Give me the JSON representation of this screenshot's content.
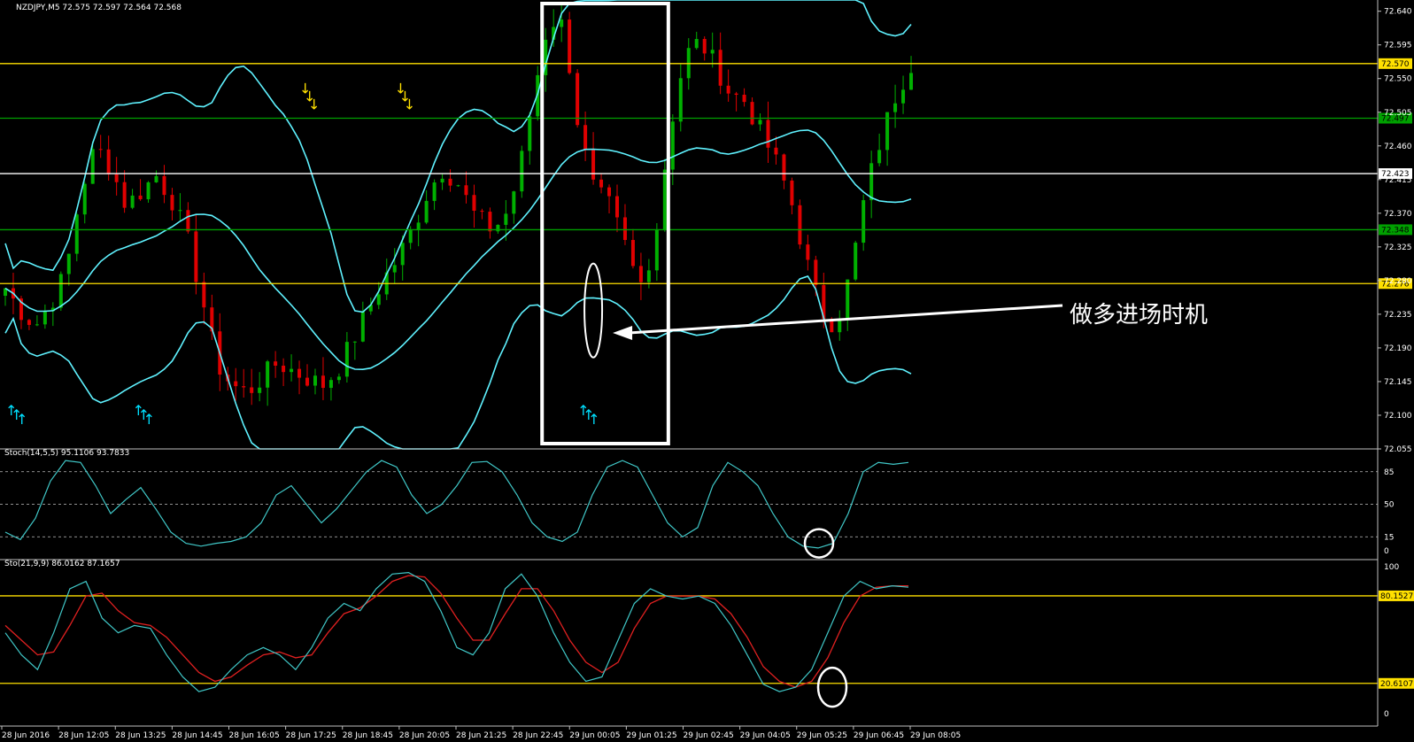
{
  "window": {
    "symbol_info": "NZDJPY,M5  72.575 72.597 72.564 72.568"
  },
  "annotation": {
    "text": "做多进场时机"
  },
  "colors": {
    "background": "#000000",
    "bull": "#00b000",
    "bear": "#e00000",
    "bands": "#5ff2ff",
    "hline_yellow": "#ffe000",
    "hline_green": "#00a000",
    "hline_white": "#ffffff",
    "stoch_main": "#40c8c8",
    "stoch_signal": "#e02020",
    "up_arrow": "#00e0ff",
    "down_arrow": "#ffe000",
    "highlight": "#ffffff"
  },
  "chart_data": [
    {
      "type": "candlestick",
      "title": "NZDJPY,M5",
      "ohlc_readout": [
        72.575,
        72.597,
        72.564,
        72.568
      ],
      "x_labels": [
        "28 Jun 2016",
        "28 Jun 12:05",
        "28 Jun 13:25",
        "28 Jun 14:45",
        "28 Jun 16:05",
        "28 Jun 17:25",
        "28 Jun 18:45",
        "28 Jun 20:05",
        "28 Jun 21:25",
        "28 Jun 22:45",
        "29 Jun 00:05",
        "29 Jun 01:25",
        "29 Jun 02:45",
        "29 Jun 04:05",
        "29 Jun 05:25",
        "29 Jun 06:45",
        "29 Jun 08:05"
      ],
      "y_ticks": [
        72.64,
        72.595,
        72.55,
        72.505,
        72.46,
        72.415,
        72.37,
        72.325,
        72.28,
        72.235,
        72.19,
        72.145,
        72.1,
        72.055
      ],
      "ylim": [
        72.055,
        72.655
      ],
      "close_path": [
        72.27,
        72.24,
        72.22,
        72.25,
        72.29,
        72.4,
        72.46,
        72.43,
        72.38,
        72.4,
        72.42,
        72.39,
        72.34,
        72.26,
        72.17,
        72.14,
        72.13,
        72.15,
        72.17,
        72.16,
        72.15,
        72.14,
        72.16,
        72.2,
        72.24,
        72.28,
        72.31,
        72.35,
        72.4,
        72.43,
        72.41,
        72.37,
        72.35,
        72.36,
        72.42,
        72.53,
        72.63,
        72.62,
        72.48,
        72.4,
        72.38,
        72.33,
        72.27,
        72.33,
        72.48,
        72.58,
        72.6,
        72.57,
        72.53,
        72.52,
        72.48,
        72.44,
        72.39,
        72.31,
        72.24,
        72.22,
        72.29,
        72.4,
        72.47,
        72.53,
        72.57
      ],
      "levels": [
        {
          "value": 72.57,
          "label": "72.570",
          "color": "#ffe000"
        },
        {
          "value": 72.497,
          "label": "72.497",
          "color": "#00a000"
        },
        {
          "value": 72.423,
          "label": "72.423",
          "color": "#ffffff"
        },
        {
          "value": 72.348,
          "label": "72.348",
          "color": "#00a000"
        },
        {
          "value": 72.276,
          "label": "72.276",
          "color": "#ffe000"
        }
      ],
      "up_arrow_clusters": [
        0,
        16,
        72
      ],
      "down_arrow_clusters": [
        37,
        49
      ],
      "highlight_box_bars": [
        68,
        83
      ]
    },
    {
      "type": "line",
      "title": "Stoch(14,5,5) 95.1106 93.7833",
      "ylim": [
        0,
        100
      ],
      "y_ticks": [
        85,
        50,
        15,
        0
      ],
      "levels": [
        85,
        50,
        15
      ],
      "main": [
        20,
        12,
        35,
        75,
        97,
        95,
        70,
        40,
        55,
        68,
        45,
        20,
        8,
        5,
        8,
        10,
        15,
        30,
        60,
        70,
        50,
        30,
        45,
        65,
        85,
        97,
        90,
        60,
        40,
        50,
        70,
        95,
        96,
        85,
        60,
        30,
        15,
        10,
        20,
        60,
        90,
        97,
        90,
        60,
        30,
        15,
        25,
        70,
        95,
        85,
        70,
        40,
        15,
        5,
        3,
        8,
        40,
        85,
        95,
        93,
        95
      ]
    },
    {
      "type": "line",
      "title": "Sto(21,9,9) 86.0162 87.1657",
      "ylim": [
        0,
        100
      ],
      "y_ticks": [
        100,
        0
      ],
      "levels": [
        {
          "value": 80.1527,
          "label": "80.1527"
        },
        {
          "value": 20.6107,
          "label": "20.6107"
        }
      ],
      "main": [
        55,
        40,
        30,
        55,
        85,
        90,
        65,
        55,
        60,
        58,
        40,
        25,
        15,
        18,
        30,
        40,
        45,
        40,
        30,
        45,
        65,
        75,
        70,
        85,
        95,
        96,
        90,
        70,
        45,
        40,
        55,
        85,
        95,
        80,
        55,
        35,
        22,
        25,
        50,
        75,
        85,
        80,
        78,
        80,
        75,
        60,
        40,
        20,
        15,
        18,
        30,
        55,
        80,
        90,
        85,
        87,
        86
      ],
      "signal": [
        60,
        50,
        40,
        42,
        60,
        80,
        82,
        70,
        62,
        60,
        52,
        40,
        28,
        22,
        25,
        33,
        40,
        42,
        38,
        40,
        55,
        68,
        72,
        80,
        90,
        94,
        93,
        82,
        65,
        50,
        50,
        68,
        85,
        85,
        70,
        50,
        35,
        28,
        35,
        58,
        75,
        80,
        80,
        80,
        78,
        68,
        52,
        32,
        22,
        18,
        22,
        38,
        62,
        80,
        86,
        87,
        87
      ]
    }
  ]
}
